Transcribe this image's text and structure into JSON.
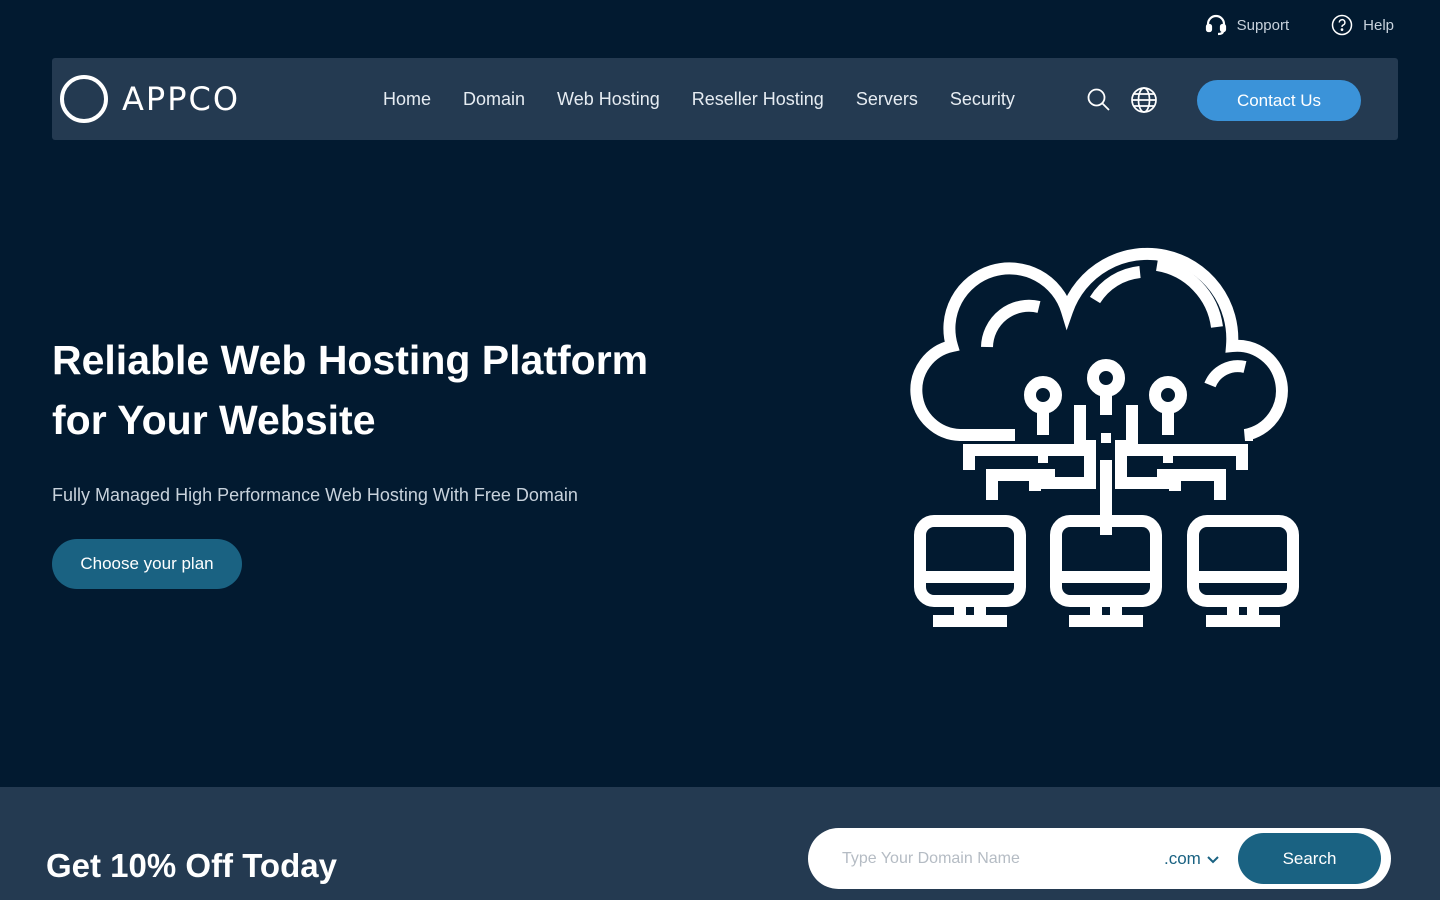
{
  "utility": {
    "support_label": "Support",
    "help_label": "Help"
  },
  "navbar": {
    "logo_text": "APPCO",
    "links": [
      "Home",
      "Domain",
      "Web Hosting",
      "Reseller Hosting",
      "Servers",
      "Security"
    ],
    "icons": [
      "search-icon",
      "globe-icon"
    ],
    "contact_label": "Contact Us"
  },
  "hero": {
    "title_line1": "Reliable Web Hosting Platform",
    "title_line2": "for Your Website",
    "subtitle": "Fully Managed High Performance Web Hosting With Free Domain",
    "cta_label": "Choose your plan",
    "illustration": "cloud-network-icon"
  },
  "promo": {
    "title": "Get 10% Off Today",
    "domain_placeholder": "Type Your Domain Name",
    "tld_selected": ".com",
    "search_label": "Search"
  },
  "colors": {
    "background": "#021a30",
    "panel": "#243a51",
    "accent_blue": "#3b93d9",
    "accent_teal": "#1a6282"
  }
}
